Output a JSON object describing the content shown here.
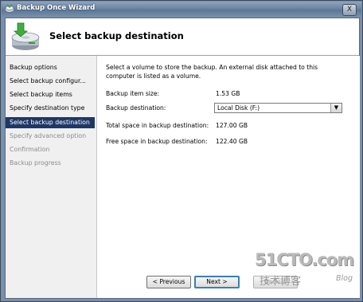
{
  "window": {
    "title": "Backup Once Wizard",
    "close_label": "X"
  },
  "header": {
    "title": "Select backup destination",
    "icon": "backup-disk-icon"
  },
  "nav": {
    "items": [
      {
        "label": "Backup options",
        "state": "normal"
      },
      {
        "label": "Select backup configur...",
        "state": "normal"
      },
      {
        "label": "Select backup items",
        "state": "normal"
      },
      {
        "label": "Specify destination type",
        "state": "normal"
      },
      {
        "label": "Select backup destination",
        "state": "selected"
      },
      {
        "label": "Specify advanced option",
        "state": "disabled"
      },
      {
        "label": "Confirmation",
        "state": "disabled"
      },
      {
        "label": "Backup progress",
        "state": "disabled"
      }
    ]
  },
  "content": {
    "description": "Select a volume to store the backup. An external disk attached to this computer is listed as a volume.",
    "item_size_label": "Backup item size:",
    "item_size_value": "1.53 GB",
    "destination_label": "Backup destination:",
    "destination_value": "Local Disk (F:)",
    "total_space_label": "Total space in backup destination:",
    "total_space_value": "127.00 GB",
    "free_space_label": "Free space in backup destination:",
    "free_space_value": "122.40 GB"
  },
  "buttons": {
    "previous": "< Previous",
    "next": "Next >",
    "backup": "Backup"
  },
  "watermark": {
    "main": "51CTO.com",
    "sub": "技术博客",
    "blog": "Blog"
  },
  "colors": {
    "selected_nav": "#1f3766",
    "titlebar": "#6d86a3"
  }
}
